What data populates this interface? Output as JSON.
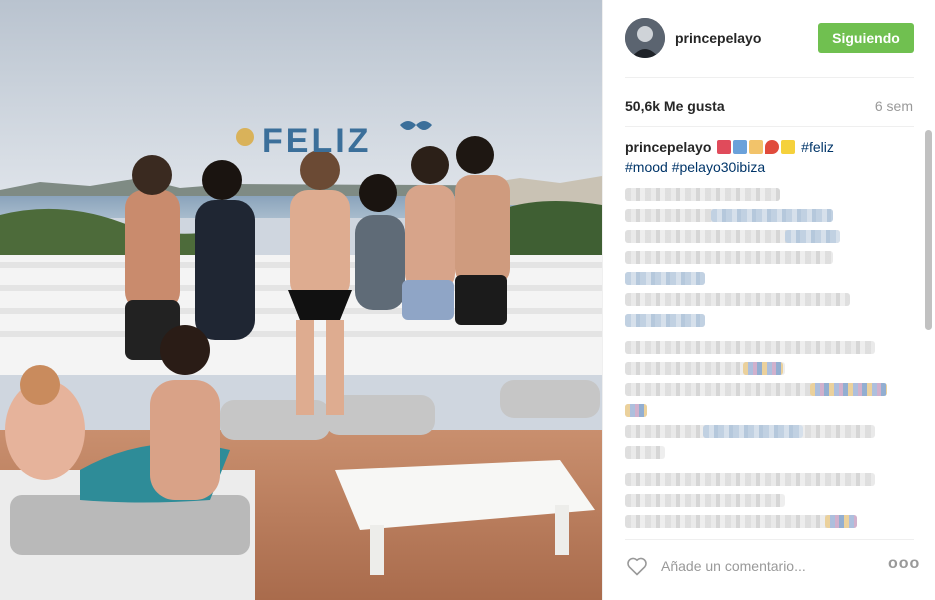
{
  "post": {
    "username": "princepelayo",
    "follow_label": "Siguiendo",
    "likes": "50,6k Me gusta",
    "time": "6 sem",
    "caption_user": "princepelayo",
    "caption_emoji": [
      "ðŸŽ",
      "ðŸŽ‰",
      "ðŸ’ª",
      "ðŸ“",
      "âš¡"
    ],
    "hashtags": [
      "#feliz",
      "#mood",
      "#pelayo30ibiza"
    ],
    "photo_banner": "FELIZ"
  },
  "footer": {
    "comment_placeholder": "Añade un comentario...",
    "more_label": "ooo"
  },
  "colors": {
    "follow_button": "#70c050",
    "hashtag": "#003569",
    "muted": "#999999"
  },
  "icons": [
    "heart-icon",
    "more-options-icon",
    "avatar"
  ]
}
